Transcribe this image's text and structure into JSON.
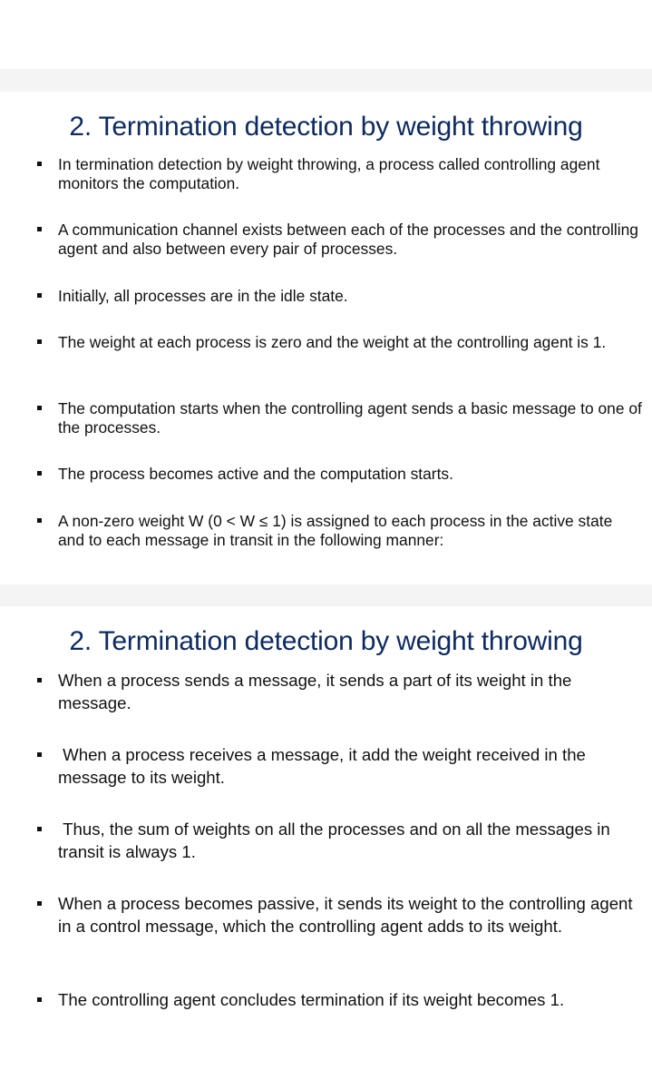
{
  "slides": [
    {
      "title": "2. Termination detection by weight throwing",
      "bullets": [
        "In termination detection by weight throwing, a process called controlling agent monitors the computation.",
        "A communication channel exists between each of the processes and the controlling agent and also between every pair of processes.",
        "Initially, all processes are in the idle state.",
        "The weight at each process is zero and the weight at the controlling agent is 1.",
        "The computation starts when the controlling agent sends a basic message to one of the processes.",
        "The process becomes active and the computation starts.",
        "A non-zero weight W (0 < W ≤ 1) is assigned to each process in the active state and to each message in transit in the following manner:"
      ]
    },
    {
      "title": "2. Termination detection by weight throwing",
      "bullets": [
        "When a process sends a message, it sends a part of its weight in the message.",
        " When a process receives a message, it add the weight received in the message to its weight.",
        " Thus, the sum of weights on all the processes and on all the messages in transit is always 1.",
        "When a process becomes passive, it sends its weight to the controlling agent in a control message, which the controlling agent adds to its weight.",
        "The controlling agent concludes termination if its weight becomes 1."
      ]
    }
  ],
  "colors": {
    "title": "#0d2b62",
    "text": "#111111",
    "separator": "#f4f4f4",
    "background": "#ffffff"
  }
}
